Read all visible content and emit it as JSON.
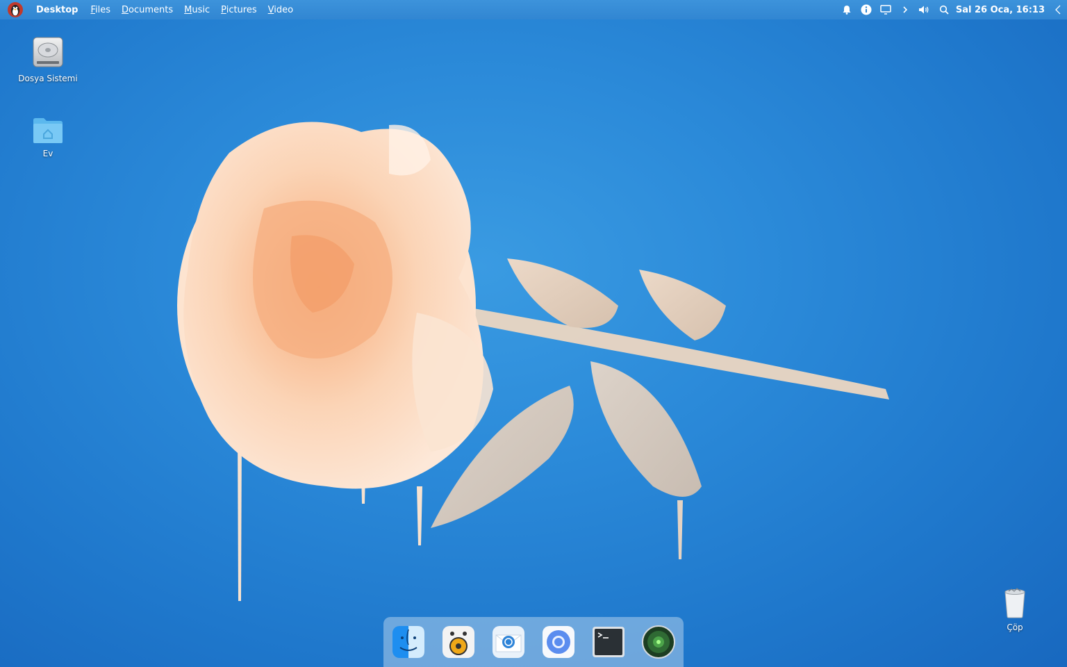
{
  "topbar": {
    "menu": [
      {
        "label": "Desktop"
      },
      {
        "label": "Files"
      },
      {
        "label": "Documents"
      },
      {
        "label": "Music"
      },
      {
        "label": "Pictures"
      },
      {
        "label": "Video"
      }
    ],
    "tray_icons": [
      "bell-icon",
      "info-icon",
      "display-icon",
      "chevron-right-icon",
      "volume-icon",
      "search-icon"
    ],
    "clock": "Sal 26 Oca, 16:13"
  },
  "desktop": {
    "icons": [
      {
        "label": "Dosya Sistemi",
        "icon": "hard-drive-icon"
      },
      {
        "label": "Ev",
        "icon": "home-folder-icon"
      },
      {
        "label": "Çöp",
        "icon": "trash-icon"
      }
    ]
  },
  "dock": {
    "apps": [
      {
        "icon": "finder-icon"
      },
      {
        "icon": "music-player-icon"
      },
      {
        "icon": "mail-icon"
      },
      {
        "icon": "browser-icon"
      },
      {
        "icon": "terminal-icon"
      },
      {
        "icon": "radar-icon"
      }
    ]
  },
  "colors": {
    "background": "#2b8ad9",
    "topbar": "#3589d4",
    "rose": "#f7c8a4"
  }
}
